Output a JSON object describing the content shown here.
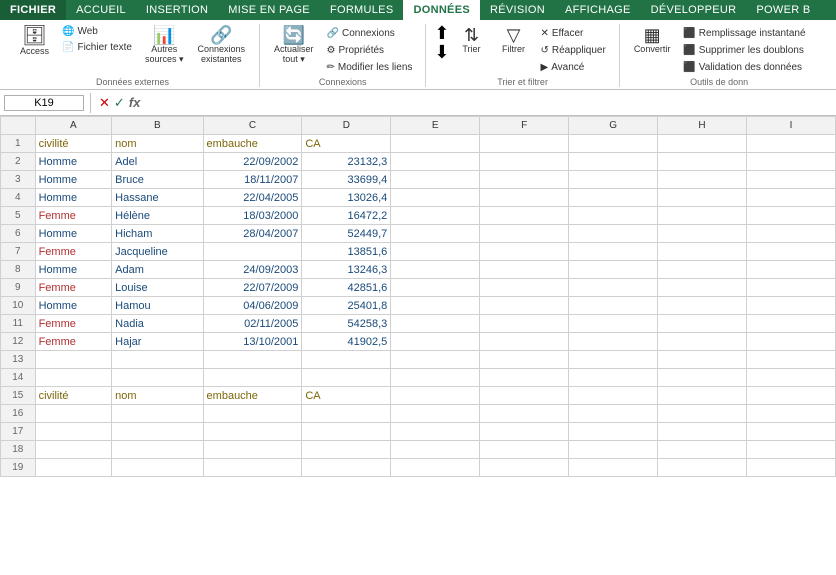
{
  "tabs": [
    "FICHIER",
    "ACCUEIL",
    "INSERTION",
    "MISE EN PAGE",
    "FORMULES",
    "DONNEES",
    "RÉVISION",
    "AFFICHAGE",
    "DÉVELOPPEUR",
    "POWER B"
  ],
  "active_tab": "DONNEES",
  "ribbon": {
    "groups": [
      {
        "label": "Données externes",
        "buttons_large": [
          {
            "id": "access",
            "icon": "🗄",
            "label": "Access"
          },
          {
            "id": "web",
            "icon": "🌐",
            "label": "Web"
          },
          {
            "id": "fichier_texte",
            "icon": "📄",
            "label": "Fichier texte"
          },
          {
            "id": "autres_sources",
            "icon": "📊",
            "label": "Autres\nsources"
          },
          {
            "id": "connexions_existantes",
            "icon": "🔗",
            "label": "Connexions\nexistantes"
          }
        ]
      },
      {
        "label": "Connexions",
        "buttons_small": [
          {
            "id": "connexions",
            "icon": "🔗",
            "label": "Connexions"
          },
          {
            "id": "proprietes",
            "icon": "⚙",
            "label": "Propriétés"
          },
          {
            "id": "modifier_liens",
            "icon": "✏",
            "label": "Modifier les liens"
          },
          {
            "id": "actualiser_tout",
            "icon": "🔄",
            "label": "Actualiser\ntout"
          }
        ]
      },
      {
        "label": "Trier et filtrer",
        "buttons": [
          {
            "id": "trier_az",
            "icon": "↑",
            "label": ""
          },
          {
            "id": "trier_za",
            "icon": "↓",
            "label": ""
          },
          {
            "id": "trier",
            "icon": "⇅",
            "label": "Trier"
          },
          {
            "id": "filtrer",
            "icon": "▽",
            "label": "Filtrer"
          },
          {
            "id": "effacer",
            "icon": "✕",
            "label": "Effacer"
          },
          {
            "id": "reappliquer",
            "icon": "↺",
            "label": "Réappliquer"
          },
          {
            "id": "avance",
            "icon": "▷",
            "label": "Avancé"
          }
        ]
      },
      {
        "label": "Outils de donn",
        "buttons_small": [
          {
            "id": "remplissage",
            "icon": "⬛",
            "label": "Remplissage instantané"
          },
          {
            "id": "supprimer_doublons",
            "icon": "⬛",
            "label": "Supprimer les doublons"
          },
          {
            "id": "validation",
            "icon": "⬛",
            "label": "Validation des données"
          },
          {
            "id": "convertir",
            "icon": "⬛",
            "label": "Convertir"
          }
        ]
      }
    ]
  },
  "formula_bar": {
    "cell_ref": "K19",
    "formula": ""
  },
  "columns": [
    "",
    "A",
    "B",
    "C",
    "D",
    "E",
    "F",
    "G",
    "H",
    "I"
  ],
  "rows": [
    {
      "num": 1,
      "cells": [
        "civilité",
        "nom",
        "embauche",
        "CA",
        "",
        "",
        "",
        "",
        ""
      ]
    },
    {
      "num": 2,
      "cells": [
        "Homme",
        "Adel",
        "22/09/2002",
        "23132,3",
        "",
        "",
        "",
        "",
        ""
      ]
    },
    {
      "num": 3,
      "cells": [
        "Homme",
        "Bruce",
        "18/11/2007",
        "33699,4",
        "",
        "",
        "",
        "",
        ""
      ]
    },
    {
      "num": 4,
      "cells": [
        "Homme",
        "Hassane",
        "22/04/2005",
        "13026,4",
        "",
        "",
        "",
        "",
        ""
      ]
    },
    {
      "num": 5,
      "cells": [
        "Femme",
        "Hélène",
        "18/03/2000",
        "16472,2",
        "",
        "",
        "",
        "",
        ""
      ]
    },
    {
      "num": 6,
      "cells": [
        "Homme",
        "Hicham",
        "28/04/2007",
        "52449,7",
        "",
        "",
        "",
        "",
        ""
      ]
    },
    {
      "num": 7,
      "cells": [
        "Femme",
        "Jacqueline",
        "",
        "13851,6",
        "",
        "",
        "",
        "",
        ""
      ]
    },
    {
      "num": 8,
      "cells": [
        "Homme",
        "Adam",
        "24/09/2003",
        "13246,3",
        "",
        "",
        "",
        "",
        ""
      ]
    },
    {
      "num": 9,
      "cells": [
        "Femme",
        "Louise",
        "22/07/2009",
        "42851,6",
        "",
        "",
        "",
        "",
        ""
      ]
    },
    {
      "num": 10,
      "cells": [
        "Homme",
        "Hamou",
        "04/06/2009",
        "25401,8",
        "",
        "",
        "",
        "",
        ""
      ]
    },
    {
      "num": 11,
      "cells": [
        "Femme",
        "Nadia",
        "02/11/2005",
        "54258,3",
        "",
        "",
        "",
        "",
        ""
      ]
    },
    {
      "num": 12,
      "cells": [
        "Femme",
        "Hajar",
        "13/10/2001",
        "41902,5",
        "",
        "",
        "",
        "",
        ""
      ]
    },
    {
      "num": 13,
      "cells": [
        "",
        "",
        "",
        "",
        "",
        "",
        "",
        "",
        ""
      ]
    },
    {
      "num": 14,
      "cells": [
        "",
        "",
        "",
        "",
        "",
        "",
        "",
        "",
        ""
      ]
    },
    {
      "num": 15,
      "cells": [
        "civilité",
        "nom",
        "embauche",
        "CA",
        "",
        "",
        "",
        "",
        ""
      ]
    },
    {
      "num": 16,
      "cells": [
        "",
        "",
        "",
        "",
        "",
        "",
        "",
        "",
        ""
      ]
    },
    {
      "num": 17,
      "cells": [
        "",
        "",
        "",
        "",
        "",
        "",
        "",
        "",
        ""
      ]
    },
    {
      "num": 18,
      "cells": [
        "",
        "",
        "",
        "",
        "",
        "",
        "",
        "",
        ""
      ]
    },
    {
      "num": 19,
      "cells": [
        "",
        "",
        "",
        "",
        "",
        "",
        "",
        "",
        ""
      ]
    }
  ],
  "cell_colors": {
    "homme": "#1a5276",
    "femme": "#922b21",
    "header": "#7d6608",
    "data_col_c": "#1a5276",
    "data_col_d": "#1a5276"
  }
}
